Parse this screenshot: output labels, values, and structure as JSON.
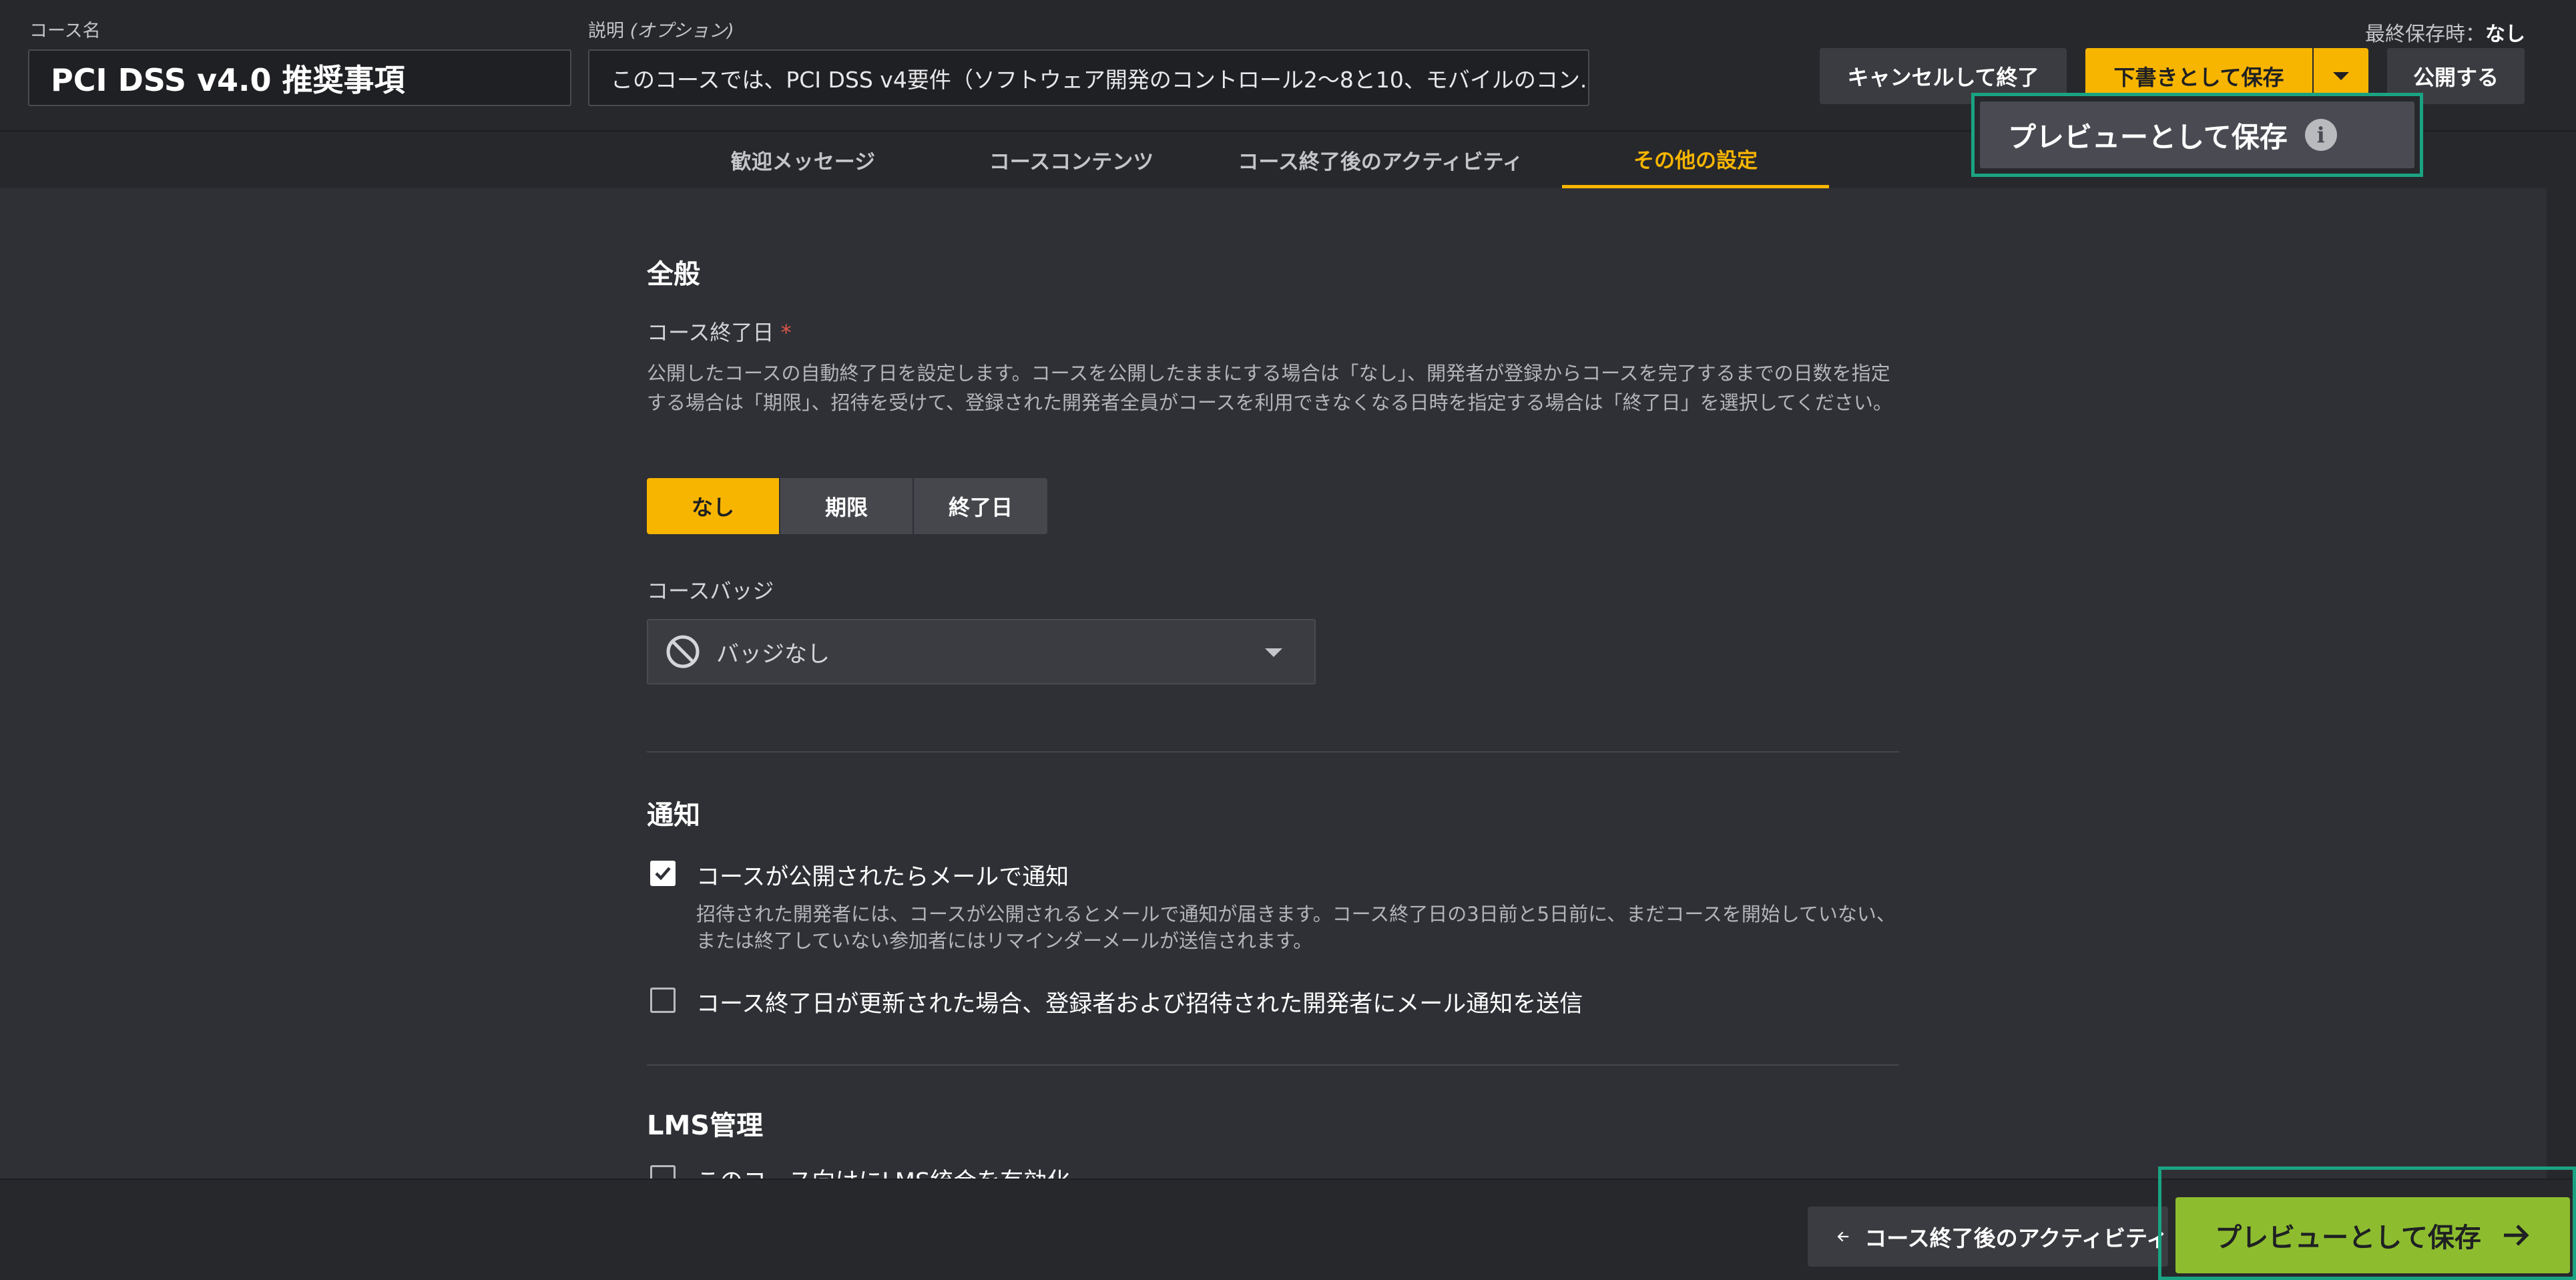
{
  "header": {
    "course_name_label": "コース名",
    "course_name_value": "PCI DSS v4.0 推奨事項",
    "description_label_prefix": "説明 ",
    "description_label_optional": "(オプション)",
    "description_value": "このコースでは、PCI DSS v4要件（ソフトウェア開発のコントロール2〜8と10、モバイルのコン...",
    "last_saved_label": "最終保存時：",
    "last_saved_value": "なし",
    "cancel_label": "キャンセルして終了",
    "save_draft_label": "下書きとして保存",
    "publish_label": "公開する"
  },
  "dropdown": {
    "preview_label": "プレビューとして保存",
    "info_glyph": "i"
  },
  "tabs": [
    {
      "label": "歓迎メッセージ",
      "active": false
    },
    {
      "label": "コースコンテンツ",
      "active": false
    },
    {
      "label": "コース終了後のアクティビティ",
      "active": false
    },
    {
      "label": "その他の設定",
      "active": true
    }
  ],
  "general": {
    "title": "全般",
    "end_date_label": "コース終了日",
    "required_mark": "*",
    "end_date_help": "公開したコースの自動終了日を設定します。コースを公開したままにする場合は「なし」、開発者が登録からコースを完了するまでの日数を指定する場合は「期限」、招待を受けて、登録された開発者全員がコースを利用できなくなる日時を指定する場合は「終了日」を選択してください。",
    "options": [
      "なし",
      "期限",
      "終了日"
    ],
    "selected_option": "なし",
    "badge_label": "コースバッジ",
    "badge_value": "バッジなし"
  },
  "notifications": {
    "title": "通知",
    "email_on_publish_label": "コースが公開されたらメールで通知",
    "email_on_publish_checked": true,
    "email_on_publish_help": "招待された開発者には、コースが公開されるとメールで通知が届きます。コース終了日の3日前と5日前に、まだコースを開始していない、または終了していない参加者にはリマインダーメールが送信されます。",
    "email_on_update_label": "コース終了日が更新された場合、登録者および招待された開発者にメール通知を送信",
    "email_on_update_checked": false
  },
  "lms": {
    "title": "LMS管理",
    "enable_label": "このコース向けにLMS統合を有効化",
    "enable_checked": false
  },
  "footer": {
    "back_label": "コース終了後のアクティビティ",
    "preview_label": "プレビューとして保存"
  },
  "colors": {
    "accent": "#f7b500",
    "preview_green": "#8dbd2f",
    "highlight_frame": "#1aa382",
    "required": "#e0554a"
  }
}
